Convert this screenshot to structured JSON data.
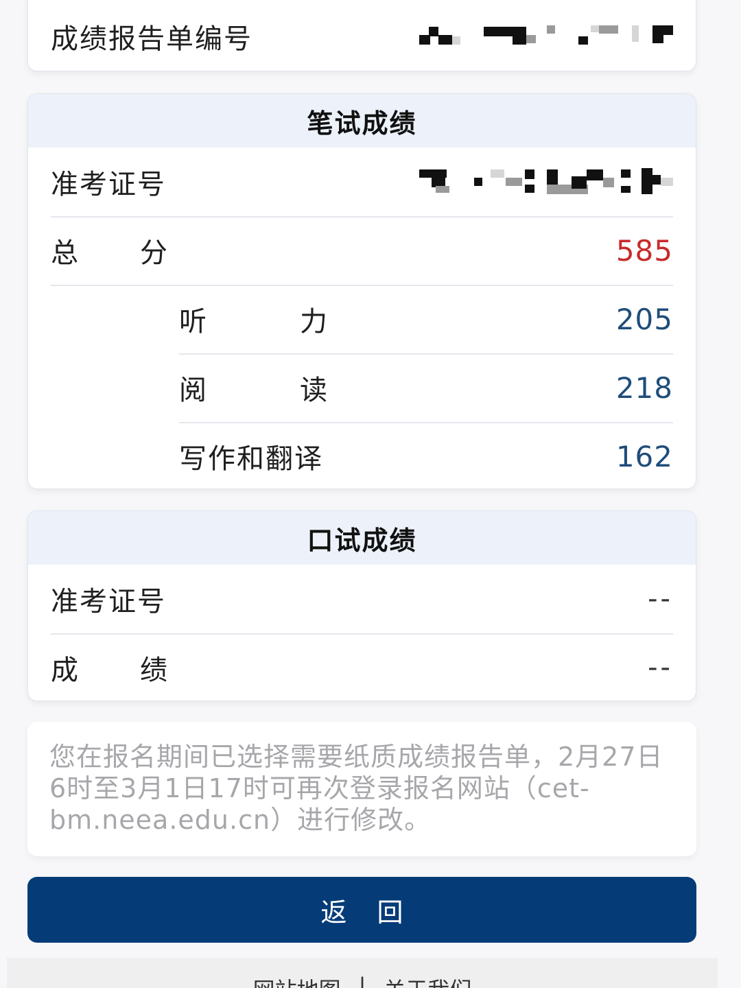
{
  "report": {
    "label": "成绩报告单编号"
  },
  "written": {
    "title": "笔试成绩",
    "admission_label": "准考证号",
    "total_label": [
      "总",
      "分"
    ],
    "total_value": "585",
    "listening_label": [
      "听",
      "力"
    ],
    "listening_value": "205",
    "reading_label": [
      "阅",
      "读"
    ],
    "reading_value": "218",
    "writing_label": "写作和翻译",
    "writing_value": "162"
  },
  "oral": {
    "title": "口试成绩",
    "admission_label": "准考证号",
    "admission_value": "--",
    "score_label": [
      "成",
      "绩"
    ],
    "score_value": "--"
  },
  "notice": {
    "text": "您在报名期间已选择需要纸质成绩报告单，2月27日6时至3月1日17时可再次登录报名网站（cet-bm.neea.edu.cn）进行修改。"
  },
  "buttons": {
    "back_label": "返回"
  },
  "footer": {
    "sitemap_label": "网站地图",
    "separator": "|",
    "about_label": "关于我们"
  },
  "colors": {
    "accent": "#053c78",
    "total_score": "#c82a2a",
    "sub_score": "#1f4d7a",
    "header_bg": "#edf2fa"
  }
}
